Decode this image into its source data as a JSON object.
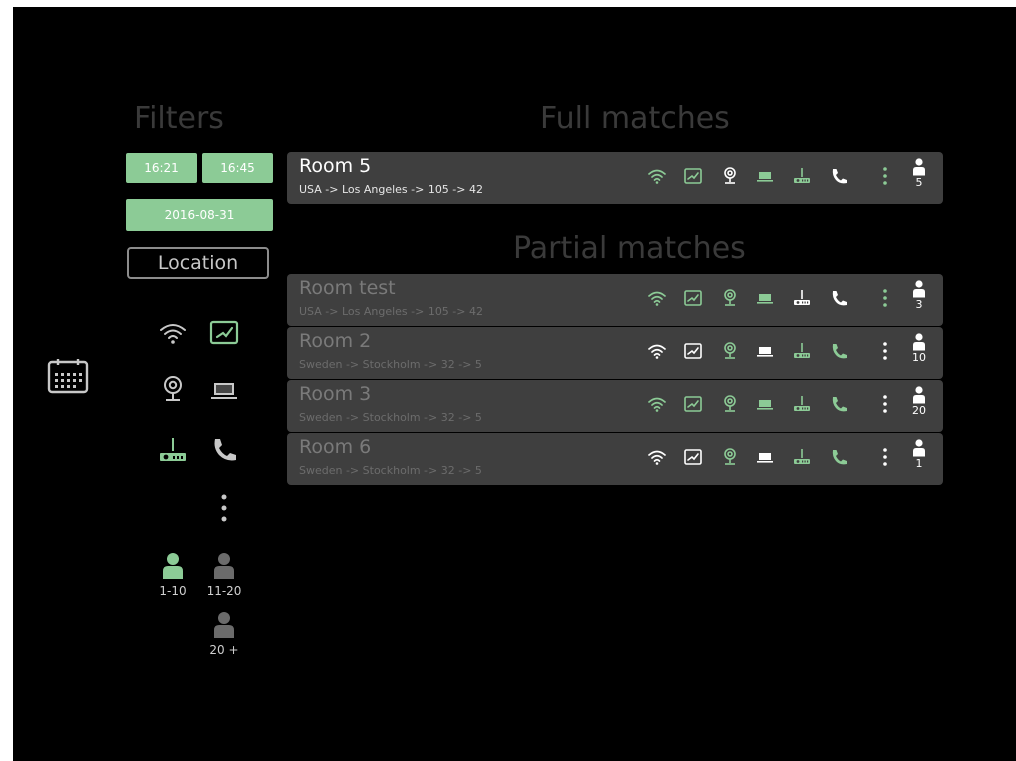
{
  "filters": {
    "heading": "Filters",
    "time_from": "16:21",
    "time_to": "16:45",
    "date": "2016-08-31",
    "location_label": "Location",
    "icons": [
      {
        "name": "wifi-icon",
        "color": "#c8c8c8"
      },
      {
        "name": "whiteboard-icon",
        "color": "#8ccb96"
      },
      {
        "name": "webcam-icon",
        "color": "#c8c8c8"
      },
      {
        "name": "laptop-icon",
        "color": "#c8c8c8"
      },
      {
        "name": "projector-icon",
        "color": "#8ccb96"
      },
      {
        "name": "phone-icon",
        "color": "#c8c8c8"
      },
      {
        "name": "more-icon",
        "color": "#c8c8c8"
      }
    ],
    "capacity": [
      {
        "label": "1-10",
        "active": true
      },
      {
        "label": "11-20",
        "active": false
      },
      {
        "label": "20 +",
        "active": false
      }
    ]
  },
  "calendar_icon": "calendar-icon",
  "full_matches": {
    "heading": "Full matches",
    "rooms": [
      {
        "name": "Room 5",
        "path": "USA -> Los Angeles -> 105 -> 42",
        "count": "5",
        "icon_colors": [
          "#8ccb96",
          "#8ccb96",
          "#ffffff",
          "#8ccb96",
          "#8ccb96",
          "#ffffff",
          "#8ccb96"
        ]
      }
    ]
  },
  "partial_matches": {
    "heading": "Partial matches",
    "rooms": [
      {
        "name": "Room test",
        "path": "USA -> Los Angeles -> 105 -> 42",
        "count": "3",
        "icon_colors": [
          "#8ccb96",
          "#8ccb96",
          "#8ccb96",
          "#8ccb96",
          "#ffffff",
          "#ffffff",
          "#8ccb96"
        ]
      },
      {
        "name": "Room 2",
        "path": "Sweden -> Stockholm -> 32 -> 5",
        "count": "10",
        "icon_colors": [
          "#ffffff",
          "#ffffff",
          "#8ccb96",
          "#ffffff",
          "#8ccb96",
          "#8ccb96",
          "#ffffff"
        ]
      },
      {
        "name": "Room 3",
        "path": "Sweden -> Stockholm -> 32 -> 5",
        "count": "20",
        "icon_colors": [
          "#8ccb96",
          "#8ccb96",
          "#8ccb96",
          "#8ccb96",
          "#8ccb96",
          "#8ccb96",
          "#ffffff"
        ]
      },
      {
        "name": "Room 6",
        "path": "Sweden -> Stockholm -> 32 -> 5",
        "count": "1",
        "icon_colors": [
          "#ffffff",
          "#ffffff",
          "#8ccb96",
          "#ffffff",
          "#8ccb96",
          "#8ccb96",
          "#ffffff"
        ]
      }
    ]
  }
}
